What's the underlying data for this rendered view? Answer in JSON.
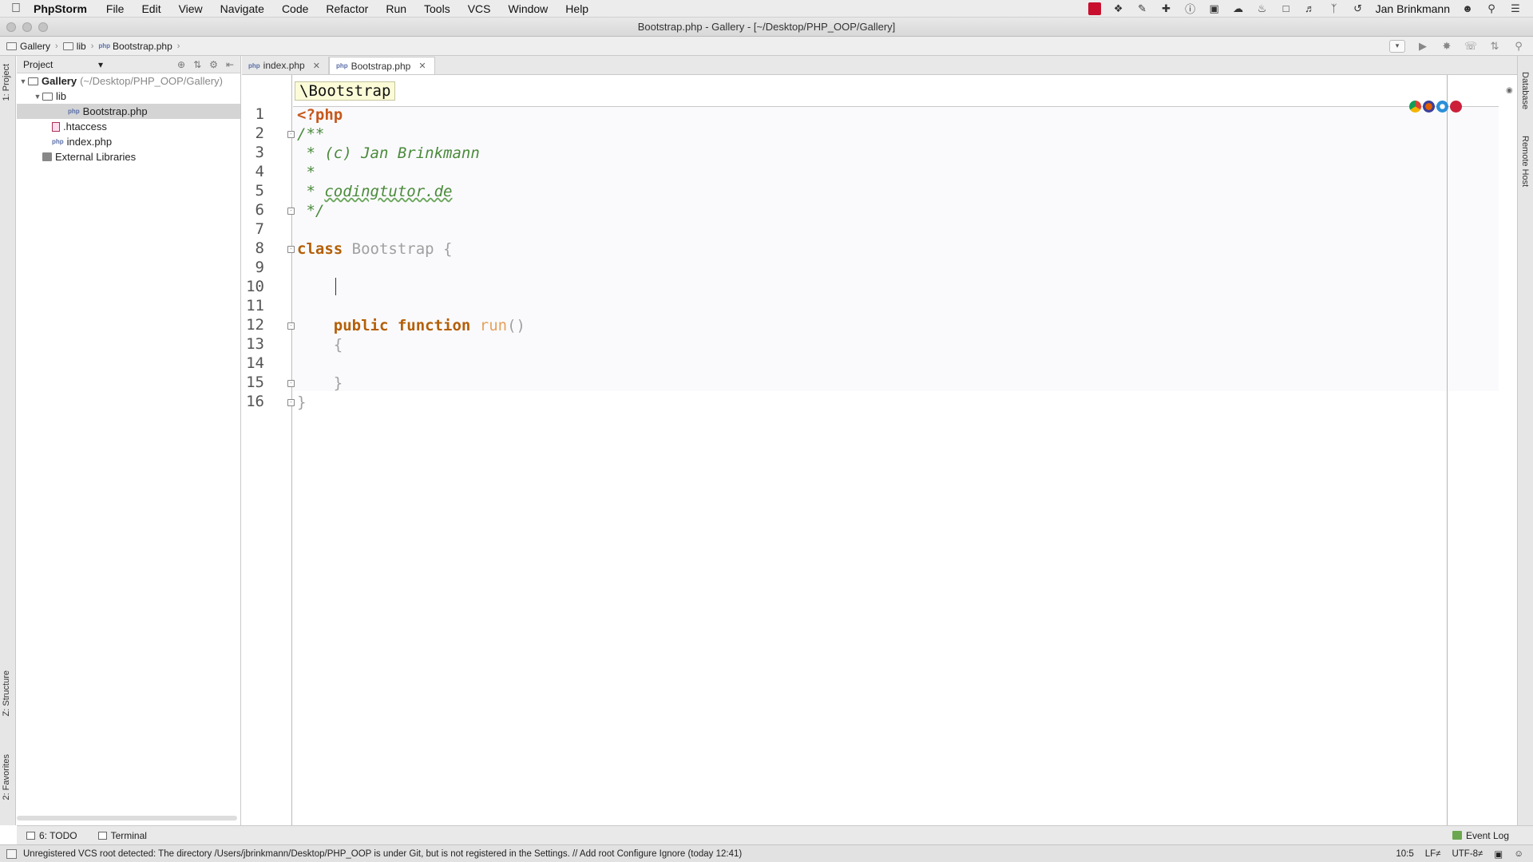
{
  "menubar": {
    "app": "PhpStorm",
    "items": [
      "File",
      "Edit",
      "View",
      "Navigate",
      "Code",
      "Refactor",
      "Run",
      "Tools",
      "VCS",
      "Window",
      "Help"
    ],
    "user": "Jan Brinkmann",
    "tray_icons": [
      "app-red-icon",
      "dropbox-icon",
      "pen-icon",
      "plus-icon",
      "info-icon",
      "book-icon",
      "cloud-icon",
      "evernote-icon",
      "monitor-icon",
      "volume-icon",
      "bluetooth-icon",
      "time-machine-icon"
    ]
  },
  "window": {
    "title": "Bootstrap.php - Gallery - [~/Desktop/PHP_OOP/Gallery]"
  },
  "navbar": {
    "breadcrumbs": [
      "Gallery",
      "lib",
      "Bootstrap.php"
    ]
  },
  "tool_windows": {
    "left": {
      "project": "1: Project",
      "structure": "Z: Structure",
      "favorites": "2: Favorites"
    },
    "right": {
      "database": "Database",
      "remote_host": "Remote Host"
    }
  },
  "project": {
    "selector": "Project",
    "tree": [
      {
        "label": "Gallery",
        "hint": "(~/Desktop/PHP_OOP/Gallery)"
      },
      {
        "label": "lib"
      },
      {
        "label": "Bootstrap.php"
      },
      {
        "label": ".htaccess"
      },
      {
        "label": "index.php"
      },
      {
        "label": "External Libraries"
      }
    ]
  },
  "tabs": [
    {
      "label": "index.php"
    },
    {
      "label": "Bootstrap.php"
    }
  ],
  "editor": {
    "breadcrumb_tip": "\\Bootstrap",
    "line_numbers": [
      "1",
      "2",
      "3",
      "4",
      "5",
      "6",
      "7",
      "8",
      "9",
      "10",
      "11",
      "12",
      "13",
      "14",
      "15",
      "16"
    ],
    "code": {
      "l1": "<?php",
      "l2": "/**",
      "l3": " * (c) Jan Brinkmann",
      "l4": " *",
      "l5_star": " * ",
      "l5_link": "codingtutor.de",
      "l6": " */",
      "l8_kw": "class",
      "l8_name": " Bootstrap {",
      "l12_kw": "    public function",
      "l12_fn": " run",
      "l12_paren": "()",
      "l13": "    {",
      "l15": "    }",
      "l16": "}"
    }
  },
  "bottom": {
    "todo": "6: TODO",
    "terminal": "Terminal",
    "event_log": "Event Log"
  },
  "status": {
    "message": "Unregistered VCS root detected: The directory /Users/jbrinkmann/Desktop/PHP_OOP is under Git, but is not registered in the Settings. // Add root  Configure  Ignore (today 12:41)",
    "position": "10:5",
    "line_sep": "LF≠",
    "encoding": "UTF-8≠"
  }
}
